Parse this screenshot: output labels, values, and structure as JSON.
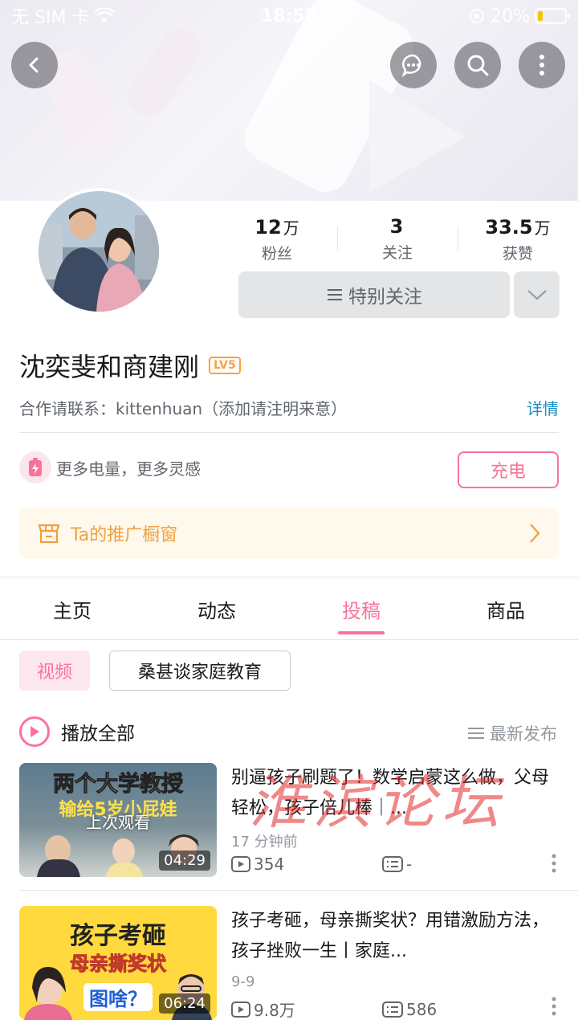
{
  "status_bar": {
    "carrier": "无 SIM 卡",
    "time": "18:58",
    "battery": "20%",
    "battery_level": 0.2
  },
  "profile": {
    "stats": [
      {
        "num": "12",
        "unit": "万",
        "label": "粉丝"
      },
      {
        "num": "3",
        "unit": "",
        "label": "关注"
      },
      {
        "num": "33.5",
        "unit": "万",
        "label": "获赞"
      }
    ],
    "follow_label": "特别关注",
    "name": "沈奕斐和商建刚",
    "level": "LV5",
    "bio": "合作请联系：kittenhuan（添加请注明来意）",
    "bio_detail": "详情",
    "charge_text": "更多电量，更多灵感",
    "charge_button": "充电",
    "shop_window": "Ta的推广橱窗"
  },
  "tabs": [
    {
      "label": "主页",
      "active": false
    },
    {
      "label": "动态",
      "active": false
    },
    {
      "label": "投稿",
      "active": true
    },
    {
      "label": "商品",
      "active": false
    }
  ],
  "filters": {
    "active": "视频",
    "other": "桑甚谈家庭教育"
  },
  "list_header": {
    "play_all": "播放全部",
    "sort": "最新发布"
  },
  "videos": [
    {
      "title": "别逼孩子刷题了！数学启蒙这么做，父母轻松，孩子倍儿棒｜...",
      "date": "17 分钟前",
      "views": "354",
      "comments": "-",
      "duration": "04:29",
      "last_watched": "上次观看",
      "thumb_line1": "两个大学教授",
      "thumb_line2": "输给5岁小屁娃"
    },
    {
      "title": "孩子考砸，母亲撕奖状？用错激励方法，孩子挫败一生丨家庭...",
      "date": "9-9",
      "views": "9.8万",
      "comments": "586",
      "duration": "06:24",
      "thumb_line1": "孩子考砸",
      "thumb_line2": "母亲撕奖状",
      "thumb_line3": "图啥？"
    }
  ],
  "watermark": "淮滨论坛",
  "colors": {
    "accent": "#fb7299",
    "link": "#1a8fc6",
    "shop": "#f0a040",
    "level": "#ff9f3c"
  },
  "icons": [
    "back-icon",
    "message-icon",
    "search-icon",
    "more-icon",
    "chevron-down-icon",
    "battery-charge-icon",
    "shop-icon",
    "chevron-right-icon",
    "play-icon",
    "sort-icon",
    "views-icon",
    "comments-icon",
    "menu-icon"
  ]
}
